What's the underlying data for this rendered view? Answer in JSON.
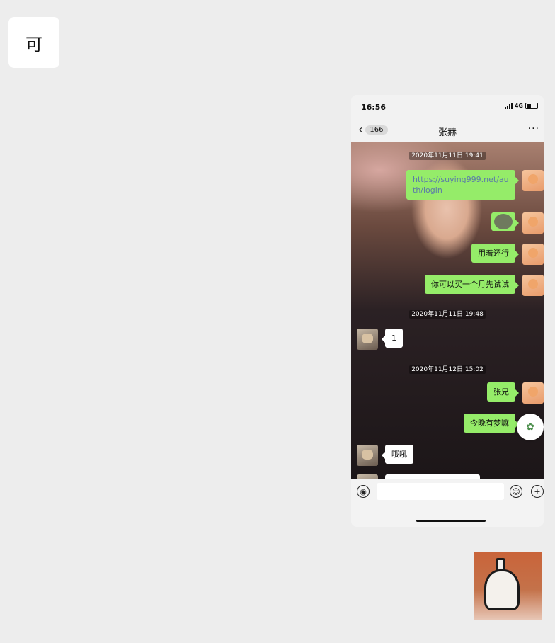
{
  "top_bubble": {
    "text": "可"
  },
  "phone": {
    "status_bar": {
      "time": "16:56",
      "network": "4G"
    },
    "nav": {
      "back_count": "166",
      "title": "张赫",
      "more": "···"
    },
    "messages": [
      {
        "type": "timestamp",
        "text": "2020年11月11日 19:41"
      },
      {
        "type": "out",
        "text": "https://suying999.net/auth/login"
      },
      {
        "type": "out-voice",
        "text": ""
      },
      {
        "type": "out",
        "text": "用着还行"
      },
      {
        "type": "out",
        "text": "你可以买一个月先试试"
      },
      {
        "type": "timestamp",
        "text": "2020年11月11日 19:48"
      },
      {
        "type": "in",
        "text": "1"
      },
      {
        "type": "timestamp",
        "text": "2020年11月12日 15:02"
      },
      {
        "type": "out",
        "text": "张兄"
      },
      {
        "type": "out",
        "text": "今晚有梦嘛"
      },
      {
        "type": "in",
        "text": "哦吼"
      }
    ]
  },
  "colors": {
    "outgoing_bubble": "#95ec69",
    "incoming_bubble": "#ffffff",
    "background": "#ededed"
  }
}
